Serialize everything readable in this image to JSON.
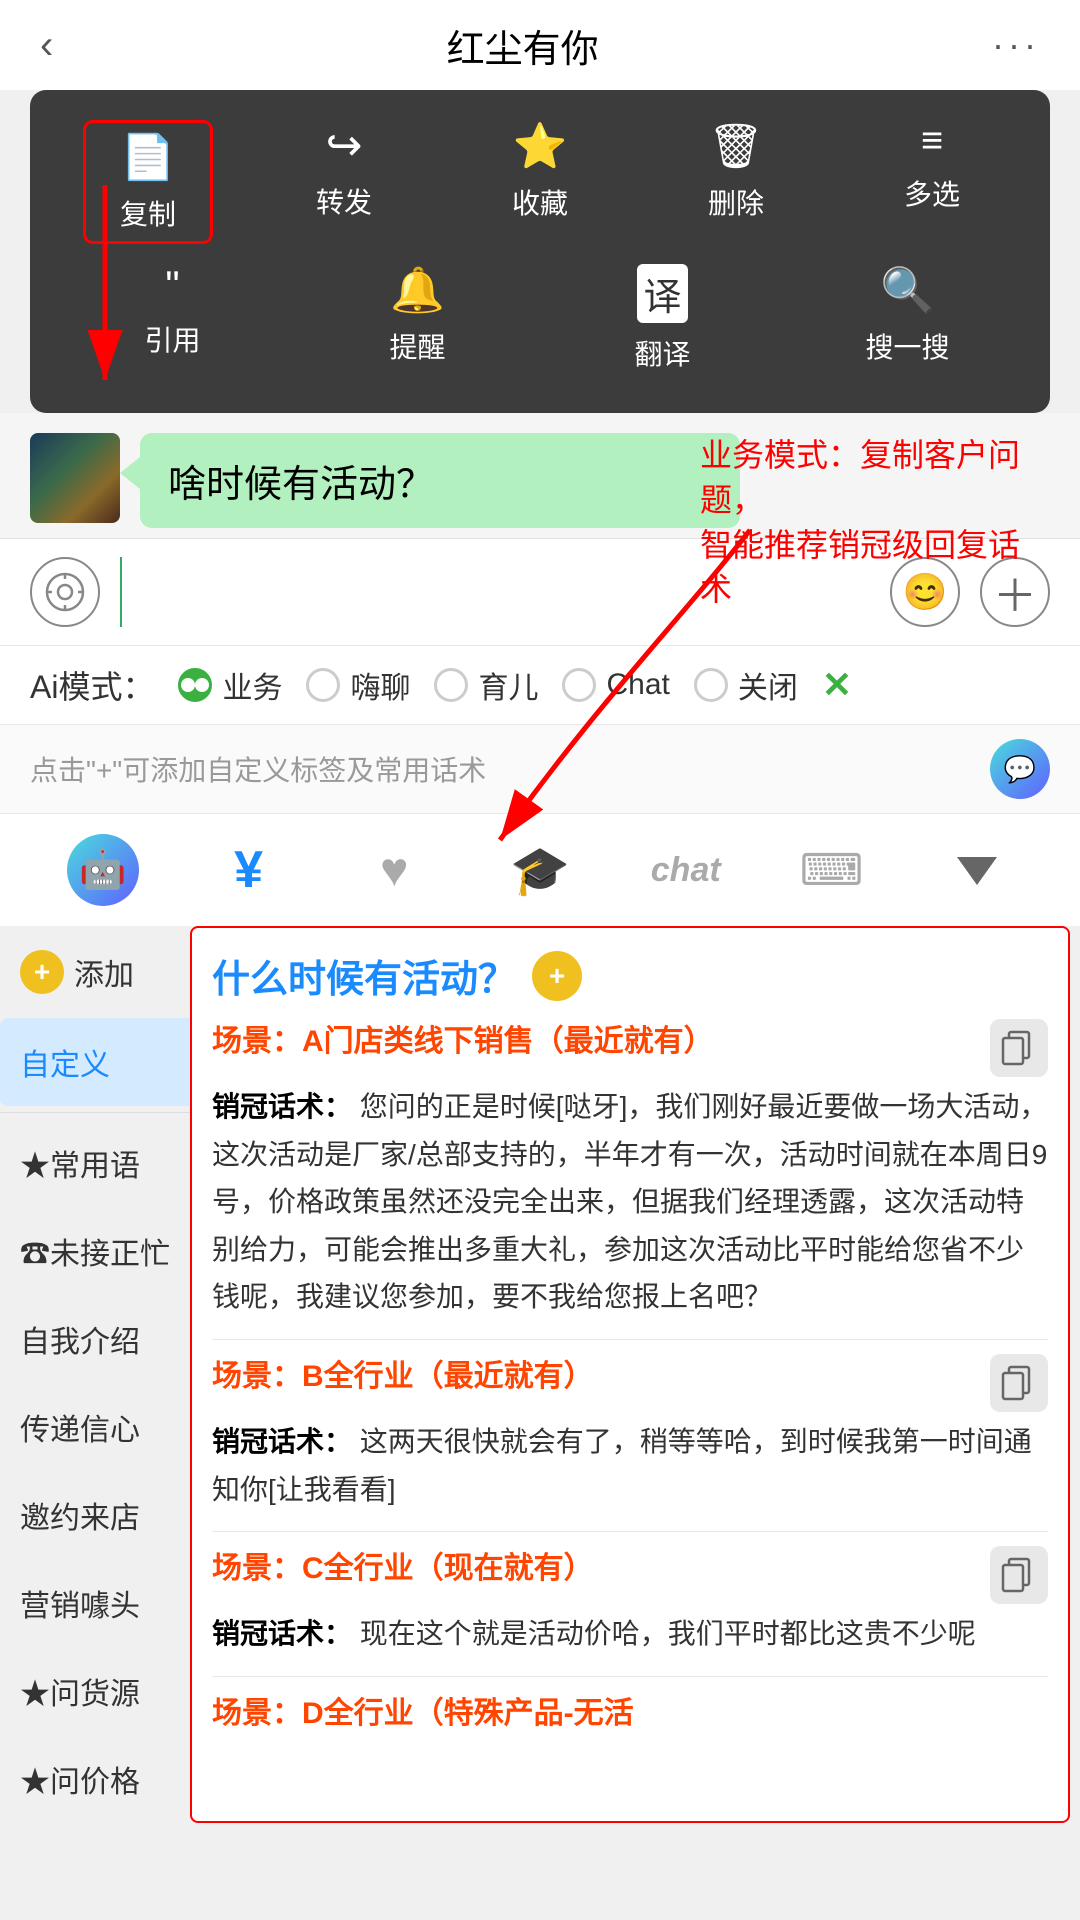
{
  "topBar": {
    "back": "‹",
    "title": "红尘有你",
    "more": "···"
  },
  "contextMenu": {
    "row1": [
      {
        "icon": "📄",
        "label": "复制",
        "highlighted": true
      },
      {
        "icon": "↪",
        "label": "转发",
        "highlighted": false
      },
      {
        "icon": "🎁",
        "label": "收藏",
        "highlighted": false
      },
      {
        "icon": "🗑",
        "label": "删除",
        "highlighted": false
      },
      {
        "icon": "☰",
        "label": "多选",
        "highlighted": false
      }
    ],
    "row2": [
      {
        "icon": "❝",
        "label": "引用",
        "highlighted": false
      },
      {
        "icon": "🔔",
        "label": "提醒",
        "highlighted": false
      },
      {
        "icon": "译",
        "label": "翻译",
        "highlighted": false
      },
      {
        "icon": "🔍",
        "label": "搜一搜",
        "highlighted": false
      }
    ]
  },
  "chat": {
    "bubble": "啥时候有活动？"
  },
  "annotation": {
    "text": "业务模式：复制客户问题，\n智能推荐销冠级回复话术"
  },
  "inputRow": {
    "voiceIcon": "◎",
    "emojiIcon": "😊",
    "addIcon": "+"
  },
  "aiMode": {
    "label": "Ai模式：",
    "options": [
      {
        "label": "业务",
        "active": true
      },
      {
        "label": "嗨聊",
        "active": false
      },
      {
        "label": "育儿",
        "active": false
      },
      {
        "label": "Chat",
        "active": false
      },
      {
        "label": "关闭",
        "active": false
      }
    ],
    "closeLabel": "✕"
  },
  "hint": {
    "text": "点击\"+\"可添加自定义标签及常用话术"
  },
  "toolbar": {
    "items": [
      {
        "icon": "🤖",
        "type": "robot"
      },
      {
        "icon": "¥",
        "type": "yen"
      },
      {
        "icon": "♥",
        "type": "heart"
      },
      {
        "icon": "🎓",
        "type": "hat"
      },
      {
        "icon": "chat",
        "type": "chat-text"
      },
      {
        "icon": "⌨",
        "type": "keyboard"
      },
      {
        "icon": "▼",
        "type": "down"
      }
    ]
  },
  "sidebar": {
    "addLabel": "添加",
    "items": [
      {
        "label": "自定义",
        "active": true
      },
      {
        "label": "★常用语",
        "active": false
      },
      {
        "label": "☎未接正忙",
        "active": false
      },
      {
        "label": "自我介绍",
        "active": false
      },
      {
        "label": "传递信心",
        "active": false
      },
      {
        "label": "邀约来店",
        "active": false
      },
      {
        "label": "营销噱头",
        "active": false
      },
      {
        "label": "★问货源",
        "active": false
      },
      {
        "label": "★问价格",
        "active": false
      }
    ]
  },
  "content": {
    "title": "什么时候有活动？",
    "scenarios": [
      {
        "title": "场景：A门店类线下销售（最近就有）",
        "scriptLabel": "销冠话术：",
        "script": "您问的正是时候[哒牙]，我们刚好最近要做一场大活动，这次活动是厂家/总部支持的，半年才有一次，活动时间就在本周日9号，价格政策虽然还没完全出来，但据我们经理透露，这次活动特别给力，可能会推出多重大礼，参加这次活动比平时能给您省不少钱呢，我建议您参加，要不我给您报上名吧？"
      },
      {
        "title": "场景：B全行业（最近就有）",
        "scriptLabel": "销冠话术：",
        "script": "这两天很快就会有了，稍等等哈，到时候我第一时间通知你[让我看看]"
      },
      {
        "title": "场景：C全行业（现在就有）",
        "scriptLabel": "销冠话术：",
        "script": "现在这个就是活动价哈，我们平时都比这贵不少呢"
      },
      {
        "title": "场景：D全行业（特殊产品-无活",
        "scriptLabel": "",
        "script": ""
      }
    ]
  }
}
